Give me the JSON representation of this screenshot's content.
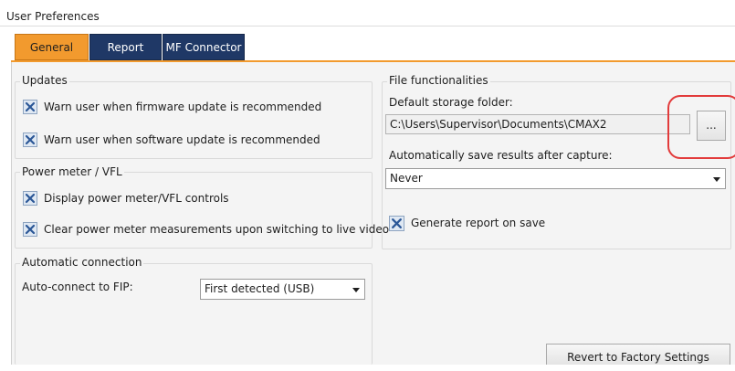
{
  "window": {
    "title": "User Preferences"
  },
  "tabs": [
    {
      "label": "General",
      "active": true
    },
    {
      "label": "Report",
      "active": false
    },
    {
      "label": "MF Connector",
      "active": false
    }
  ],
  "updates": {
    "title": "Updates",
    "firmware_label": "Warn user when firmware update is recommended",
    "firmware_checked": true,
    "software_label": "Warn user when software update is recommended",
    "software_checked": true
  },
  "power_meter": {
    "title": "Power meter / VFL",
    "display_label": "Display power meter/VFL controls",
    "display_checked": true,
    "clear_label": "Clear power meter measurements upon switching to live video",
    "clear_checked": true
  },
  "auto_connection": {
    "title": "Automatic connection",
    "label": "Auto-connect to FIP:",
    "value": "First detected (USB)"
  },
  "file": {
    "title": "File functionalities",
    "storage_label": "Default storage folder:",
    "storage_path": "C:\\Users\\Supervisor\\Documents\\CMAX2",
    "browse_label": "...",
    "autosave_label": "Automatically save results after capture:",
    "autosave_value": "Never",
    "report_label": "Generate report on save",
    "report_checked": true
  },
  "revert_label": "Revert to Factory Settings",
  "colors": {
    "tab_active": "#f29a2e",
    "tab_inactive": "#1f3866",
    "highlight": "#e23b3b",
    "checkmark": "#2b5797"
  }
}
